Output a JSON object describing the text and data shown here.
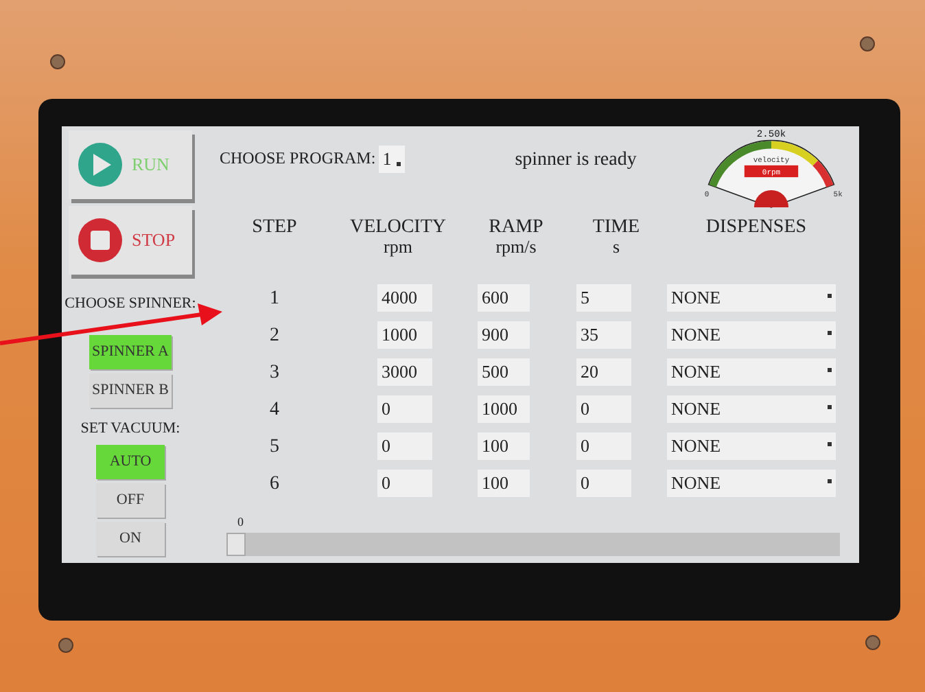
{
  "run_button": {
    "label": "RUN"
  },
  "stop_button": {
    "label": "STOP"
  },
  "program": {
    "label": "CHOOSE PROGRAM:",
    "value": "1"
  },
  "status": "spinner is ready",
  "gauge": {
    "top_label": "2.50k",
    "title": "velocity",
    "reading": "0rpm",
    "min_label": "0",
    "max_label": "5k"
  },
  "spinner": {
    "label": "CHOOSE SPINNER:",
    "options": [
      {
        "label": "SPINNER A",
        "selected": true
      },
      {
        "label": "SPINNER B",
        "selected": false
      }
    ]
  },
  "vacuum": {
    "label": "SET VACUUM:",
    "options": [
      {
        "label": "AUTO",
        "selected": true
      },
      {
        "label": "OFF",
        "selected": false
      },
      {
        "label": "ON",
        "selected": false
      }
    ]
  },
  "table": {
    "columns": [
      {
        "title": "STEP"
      },
      {
        "title": "VELOCITY",
        "unit": "rpm"
      },
      {
        "title": "RAMP",
        "unit": "rpm/s"
      },
      {
        "title": "TIME",
        "unit": "s"
      },
      {
        "title": "DISPENSES"
      }
    ],
    "rows": [
      {
        "step": "1",
        "velocity": "4000",
        "ramp": "600",
        "time": "5",
        "dispenses": "NONE"
      },
      {
        "step": "2",
        "velocity": "1000",
        "ramp": "900",
        "time": "35",
        "dispenses": "NONE"
      },
      {
        "step": "3",
        "velocity": "3000",
        "ramp": "500",
        "time": "20",
        "dispenses": "NONE"
      },
      {
        "step": "4",
        "velocity": "0",
        "ramp": "1000",
        "time": "0",
        "dispenses": "NONE"
      },
      {
        "step": "5",
        "velocity": "0",
        "ramp": "100",
        "time": "0",
        "dispenses": "NONE"
      },
      {
        "step": "6",
        "velocity": "0",
        "ramp": "100",
        "time": "0",
        "dispenses": "NONE"
      }
    ]
  },
  "slider": {
    "label": "0",
    "level": 0
  }
}
